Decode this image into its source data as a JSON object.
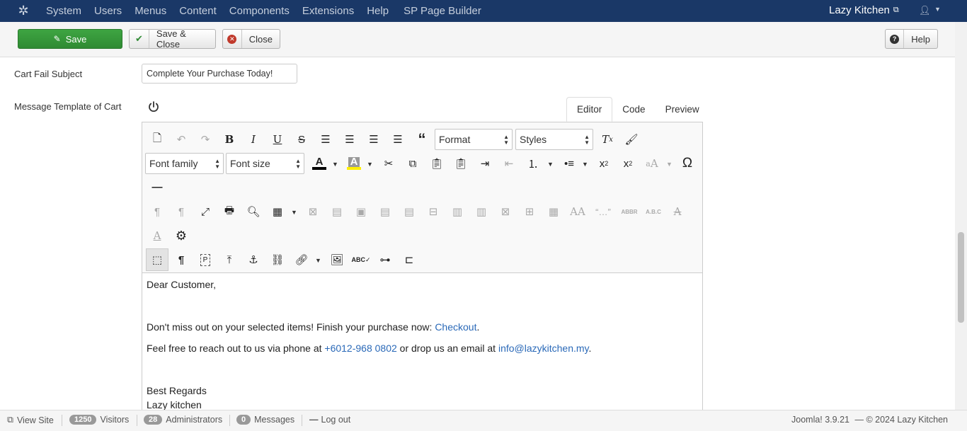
{
  "topnav": {
    "menu": [
      "System",
      "Users",
      "Menus",
      "Content",
      "Components",
      "Extensions",
      "Help",
      "SP Page Builder"
    ],
    "site_name": "Lazy Kitchen"
  },
  "toolbar": {
    "save_label": "Save",
    "save_close_label": "Save & Close",
    "close_label": "Close",
    "help_label": "Help"
  },
  "form": {
    "subject_label": "Cart Fail Subject",
    "subject_value": "Complete Your Purchase Today!",
    "template_label": "Message Template of Cart"
  },
  "editor": {
    "tabs": [
      "Editor",
      "Code",
      "Preview"
    ],
    "active_tab": "Editor",
    "format_select": "Format",
    "styles_select": "Styles",
    "font_family_select": "Font family",
    "font_size_select": "Font size",
    "icons": {
      "row1": [
        "new-document-icon",
        "undo-icon",
        "redo-icon",
        "bold-icon",
        "italic-icon",
        "underline-icon",
        "strikethrough-icon",
        "justify-icon",
        "align-center-icon",
        "align-left-icon",
        "align-right-icon",
        "blockquote-icon",
        "clear-formatting-icon",
        "paint-format-icon"
      ],
      "row2": [
        "text-color-icon",
        "background-color-icon",
        "cut-icon",
        "copy-icon",
        "paste-icon",
        "paste-text-icon",
        "indent-icon",
        "outdent-icon",
        "numbered-list-icon",
        "bullet-list-icon",
        "subscript-icon",
        "superscript-icon",
        "font-case-icon",
        "special-character-icon"
      ],
      "row3": [
        "horizontal-rule-icon"
      ],
      "row4": [
        "ltr-icon",
        "rtl-icon",
        "fullscreen-icon",
        "print-icon",
        "find-icon",
        "table-icon",
        "delete-table-icon",
        "row-props-icon",
        "cell-props-icon",
        "insert-row-before-icon",
        "insert-row-after-icon",
        "delete-row-icon",
        "insert-col-before-icon",
        "insert-col-after-icon",
        "delete-col-icon",
        "split-cells-icon",
        "merge-cells-icon",
        "style-icon",
        "quote-icon",
        "abbr-icon",
        "acronym-icon",
        "strike-style-icon"
      ],
      "row5": [
        "text-format-icon",
        "settings-icon"
      ],
      "row6": [
        "visual-aid-icon",
        "show-blocks-icon",
        "paragraph-block-icon",
        "upload-icon",
        "anchor-icon",
        "unlink-icon",
        "link-icon",
        "image-icon",
        "spellcheck-icon",
        "page-break-icon",
        "template-icon"
      ]
    },
    "content": {
      "greeting": "Dear Customer,",
      "line1_prefix": "Don't miss out on your selected items! Finish your purchase now: ",
      "line1_link": "Checkout",
      "line1_suffix": ".",
      "line2_prefix": "Feel free to reach out to us via phone at ",
      "line2_phone": "+6012-968 0802",
      "line2_mid": " or drop us an email at ",
      "line2_email": "info@lazykitchen.my",
      "line2_suffix": ".",
      "signoff": "Best Regards",
      "signature": "Lazy kitchen"
    }
  },
  "footer": {
    "view_site": "View Site",
    "visitors_count": "1250",
    "visitors_label": "Visitors",
    "admins_count": "28",
    "admins_label": "Administrators",
    "messages_count": "0",
    "messages_label": "Messages",
    "logout": "Log out",
    "version": "Joomla! 3.9.21",
    "copyright": "— © 2024 Lazy Kitchen"
  },
  "colors": {
    "nav_bg": "#1a3867",
    "save_green": "#3ea542",
    "link_blue": "#2a69b8"
  }
}
